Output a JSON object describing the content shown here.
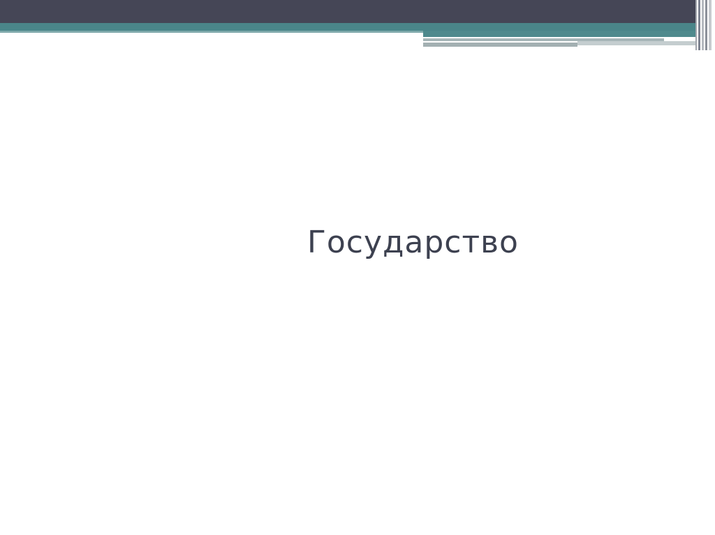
{
  "slide": {
    "title": "Государство"
  },
  "colors": {
    "header_dark": "#454656",
    "header_teal": "#4a8589",
    "title_text": "#3d4150",
    "background": "#ffffff"
  }
}
